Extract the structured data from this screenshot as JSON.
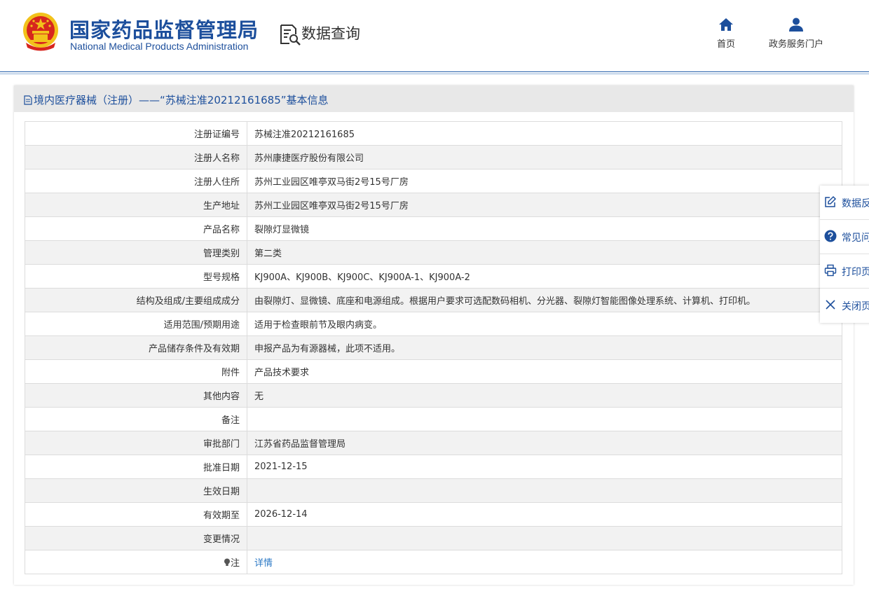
{
  "header": {
    "org_name_cn": "国家药品监督管理局",
    "org_name_en": "National Medical Products Administration",
    "section_label": "数据查询",
    "nav": [
      {
        "label": "首页",
        "icon": "home-icon"
      },
      {
        "label": "政务服务门户",
        "icon": "user-icon"
      }
    ]
  },
  "panel": {
    "title": "境内医疗器械（注册）——“苏械注准20212161685”基本信息",
    "rows": [
      {
        "key": "注册证编号",
        "value": "苏械注准20212161685"
      },
      {
        "key": "注册人名称",
        "value": "苏州康捷医疗股份有限公司"
      },
      {
        "key": "注册人住所",
        "value": "苏州工业园区唯亭双马街2号15号厂房"
      },
      {
        "key": "生产地址",
        "value": "苏州工业园区唯亭双马街2号15号厂房"
      },
      {
        "key": "产品名称",
        "value": "裂隙灯显微镜"
      },
      {
        "key": "管理类别",
        "value": "第二类"
      },
      {
        "key": "型号规格",
        "value": "KJ900A、KJ900B、KJ900C、KJ900A-1、KJ900A-2"
      },
      {
        "key": "结构及组成/主要组成成分",
        "value": "由裂隙灯、显微镜、底座和电源组成。根据用户要求可选配数码相机、分光器、裂隙灯智能图像处理系统、计算机、打印机。"
      },
      {
        "key": "适用范围/预期用途",
        "value": "适用于检查眼前节及眼内病变。"
      },
      {
        "key": "产品储存条件及有效期",
        "value": "申报产品为有源器械，此项不适用。"
      },
      {
        "key": "附件",
        "value": "产品技术要求"
      },
      {
        "key": "其他内容",
        "value": "无"
      },
      {
        "key": "备注",
        "value": ""
      },
      {
        "key": "审批部门",
        "value": "江苏省药品监督管理局"
      },
      {
        "key": "批准日期",
        "value": "2021-12-15"
      },
      {
        "key": "生效日期",
        "value": ""
      },
      {
        "key": "有效期至",
        "value": "2026-12-14"
      },
      {
        "key": "变更情况",
        "value": ""
      },
      {
        "key": "注",
        "value": "详情"
      }
    ]
  },
  "float_menu": [
    {
      "label": "数据反",
      "icon": "edit-icon"
    },
    {
      "label": "常见问",
      "icon": "question-icon"
    },
    {
      "label": "打印页",
      "icon": "printer-icon"
    },
    {
      "label": "关闭页",
      "icon": "close-icon"
    }
  ],
  "colors": {
    "brand": "#1d4f9c",
    "link": "#2b78c5",
    "emblem_red": "#d7261e",
    "emblem_gold": "#f2c21b"
  }
}
